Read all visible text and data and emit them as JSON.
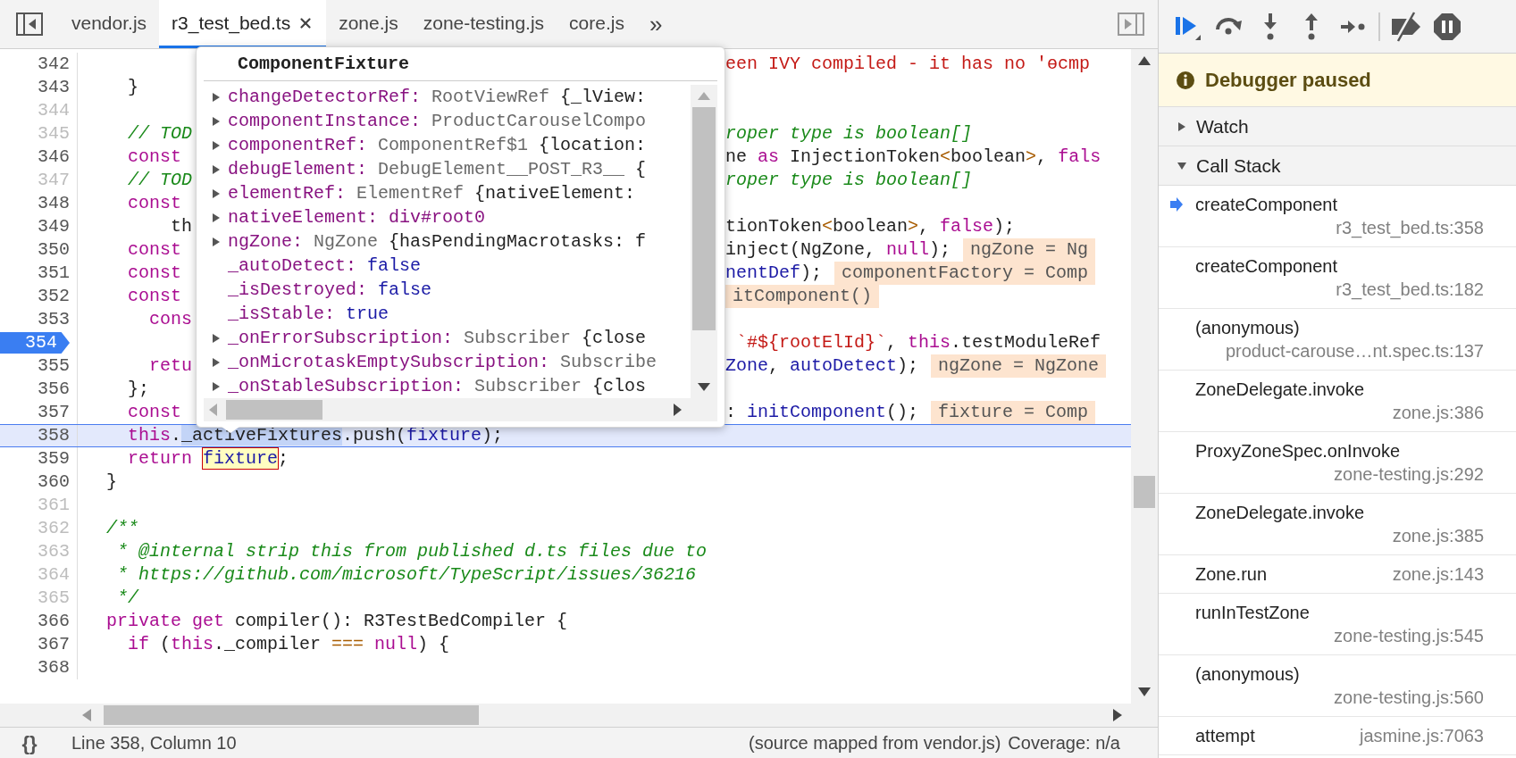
{
  "tabs": {
    "items": [
      {
        "label": "vendor.js",
        "selected": false,
        "closable": false
      },
      {
        "label": "r3_test_bed.ts",
        "selected": true,
        "closable": true
      },
      {
        "label": "zone.js",
        "selected": false,
        "closable": false
      },
      {
        "label": "zone-testing.js",
        "selected": false,
        "closable": false
      },
      {
        "label": "core.js",
        "selected": false,
        "closable": false
      }
    ],
    "more": "»"
  },
  "editor": {
    "lines": [
      {
        "n": "342",
        "kind": "split",
        "dim": false,
        "breakpoint": false,
        "current": false,
        "right": [
          {
            "kind": "str",
            "text": "een IVY compiled - it has no 'ɵcmp"
          }
        ]
      },
      {
        "n": "343",
        "kind": "split",
        "dim": false,
        "breakpoint": false,
        "current": false,
        "left": [
          {
            "kind": "p",
            "text": "    }"
          }
        ]
      },
      {
        "n": "344",
        "kind": "split",
        "dim": true,
        "breakpoint": false,
        "current": false
      },
      {
        "n": "345",
        "kind": "split",
        "dim": true,
        "breakpoint": false,
        "current": false,
        "left": [
          {
            "kind": "cm",
            "text": "    // TOD"
          }
        ],
        "right": [
          {
            "kind": "cm",
            "text": "roper type is boolean[]"
          }
        ]
      },
      {
        "n": "346",
        "kind": "split",
        "dim": false,
        "breakpoint": false,
        "current": false,
        "left": [
          {
            "kind": "kw",
            "text": "    const"
          }
        ],
        "right": [
          {
            "kind": "p",
            "text": "ne "
          },
          {
            "kind": "kw",
            "text": "as"
          },
          {
            "kind": "p",
            "text": " InjectionToken"
          },
          {
            "kind": "op",
            "text": "<"
          },
          {
            "kind": "p",
            "text": "boolean"
          },
          {
            "kind": "op",
            "text": ">"
          },
          {
            "kind": "p",
            "text": ", "
          },
          {
            "kind": "kw",
            "text": "fals"
          }
        ]
      },
      {
        "n": "347",
        "kind": "split",
        "dim": true,
        "breakpoint": false,
        "current": false,
        "left": [
          {
            "kind": "cm",
            "text": "    // TOD"
          }
        ],
        "right": [
          {
            "kind": "cm",
            "text": "roper type is boolean[]"
          }
        ]
      },
      {
        "n": "348",
        "kind": "split",
        "dim": false,
        "breakpoint": false,
        "current": false,
        "left": [
          {
            "kind": "kw",
            "text": "    const"
          }
        ]
      },
      {
        "n": "349",
        "kind": "split",
        "dim": false,
        "breakpoint": false,
        "current": false,
        "left": [
          {
            "kind": "p",
            "text": "        th"
          }
        ],
        "right": [
          {
            "kind": "p",
            "text": "tionToken"
          },
          {
            "kind": "op",
            "text": "<"
          },
          {
            "kind": "p",
            "text": "boolean"
          },
          {
            "kind": "op",
            "text": ">"
          },
          {
            "kind": "p",
            "text": ", "
          },
          {
            "kind": "kw",
            "text": "false"
          },
          {
            "kind": "p",
            "text": ");"
          }
        ]
      },
      {
        "n": "350",
        "kind": "split",
        "dim": false,
        "breakpoint": false,
        "current": false,
        "left": [
          {
            "kind": "kw",
            "text": "    const"
          }
        ],
        "right": [
          {
            "kind": "p",
            "text": "inject(NgZone, "
          },
          {
            "kind": "kw",
            "text": "null"
          },
          {
            "kind": "p",
            "text": ");"
          },
          {
            "kind": "val",
            "text": "ngZone = Ng"
          }
        ]
      },
      {
        "n": "351",
        "kind": "split",
        "dim": false,
        "breakpoint": false,
        "current": false,
        "left": [
          {
            "kind": "kw",
            "text": "    const"
          }
        ],
        "right": [
          {
            "kind": "var",
            "text": "nentDef"
          },
          {
            "kind": "p",
            "text": ");"
          },
          {
            "kind": "val",
            "text": "componentFactory = Comp"
          }
        ]
      },
      {
        "n": "352",
        "kind": "split",
        "dim": false,
        "breakpoint": false,
        "current": false,
        "left": [
          {
            "kind": "kw",
            "text": "    const"
          }
        ],
        "right": [
          {
            "kind": "val",
            "text": "itComponent()"
          }
        ]
      },
      {
        "n": "353",
        "kind": "split",
        "dim": false,
        "breakpoint": false,
        "current": false,
        "left": [
          {
            "kind": "kw",
            "text": "      cons"
          }
        ]
      },
      {
        "n": "354",
        "kind": "split",
        "dim": false,
        "breakpoint": true,
        "current": false,
        "right": [
          {
            "kind": "str",
            "text": " `#${rootElId}`"
          },
          {
            "kind": "p",
            "text": ", "
          },
          {
            "kind": "kw",
            "text": "this"
          },
          {
            "kind": "p",
            "text": ".testModuleRef"
          }
        ]
      },
      {
        "n": "355",
        "kind": "split",
        "dim": false,
        "breakpoint": false,
        "current": false,
        "left": [
          {
            "kind": "kw",
            "text": "      retu"
          }
        ],
        "right": [
          {
            "kind": "var",
            "text": "Zone"
          },
          {
            "kind": "p",
            "text": ", "
          },
          {
            "kind": "var",
            "text": "autoDetect"
          },
          {
            "kind": "p",
            "text": ");"
          },
          {
            "kind": "val",
            "text": "ngZone = NgZone"
          }
        ]
      },
      {
        "n": "356",
        "kind": "split",
        "dim": false,
        "breakpoint": false,
        "current": false,
        "left": [
          {
            "kind": "p",
            "text": "    };"
          }
        ]
      },
      {
        "n": "357",
        "kind": "split",
        "dim": false,
        "breakpoint": false,
        "current": false,
        "left": [
          {
            "kind": "kw",
            "text": "    const"
          }
        ],
        "right": [
          {
            "kind": "p",
            "text": ": "
          },
          {
            "kind": "var",
            "text": "initComponent"
          },
          {
            "kind": "p",
            "text": "();"
          },
          {
            "kind": "val",
            "text": "fixture = Comp"
          }
        ]
      },
      {
        "n": "358",
        "kind": "full",
        "dim": false,
        "breakpoint": false,
        "current": true,
        "tokens": [
          {
            "kind": "kw",
            "text": "    this"
          },
          {
            "kind": "p",
            "text": "."
          },
          {
            "kind": "sel",
            "text": "_activeFixtures"
          },
          {
            "kind": "p",
            "text": ".push("
          },
          {
            "kind": "var",
            "text": "fixture"
          },
          {
            "kind": "p",
            "text": ");"
          }
        ]
      },
      {
        "n": "359",
        "kind": "full",
        "dim": false,
        "breakpoint": false,
        "current": false,
        "tokens": [
          {
            "kind": "kw",
            "text": "    return "
          },
          {
            "kind": "hl",
            "text": "fixture"
          },
          {
            "kind": "p",
            "text": ";"
          }
        ]
      },
      {
        "n": "360",
        "kind": "full",
        "dim": false,
        "breakpoint": false,
        "current": false,
        "tokens": [
          {
            "kind": "p",
            "text": "  }"
          }
        ]
      },
      {
        "n": "361",
        "kind": "full",
        "dim": true,
        "breakpoint": false,
        "current": false
      },
      {
        "n": "362",
        "kind": "full",
        "dim": true,
        "breakpoint": false,
        "current": false,
        "tokens": [
          {
            "kind": "cm",
            "text": "  /**"
          }
        ]
      },
      {
        "n": "363",
        "kind": "full",
        "dim": true,
        "breakpoint": false,
        "current": false,
        "tokens": [
          {
            "kind": "cm",
            "text": "   * @internal strip this from published d.ts files due to"
          }
        ]
      },
      {
        "n": "364",
        "kind": "full",
        "dim": true,
        "breakpoint": false,
        "current": false,
        "tokens": [
          {
            "kind": "cm",
            "text": "   * https://github.com/microsoft/TypeScript/issues/36216"
          }
        ]
      },
      {
        "n": "365",
        "kind": "full",
        "dim": true,
        "breakpoint": false,
        "current": false,
        "tokens": [
          {
            "kind": "cm",
            "text": "   */"
          }
        ]
      },
      {
        "n": "366",
        "kind": "full",
        "dim": false,
        "breakpoint": false,
        "current": false,
        "tokens": [
          {
            "kind": "kw",
            "text": "  private get"
          },
          {
            "kind": "p",
            "text": " compiler(): R3TestBedCompiler {"
          }
        ]
      },
      {
        "n": "367",
        "kind": "full",
        "dim": false,
        "breakpoint": false,
        "current": false,
        "tokens": [
          {
            "kind": "kw",
            "text": "    if"
          },
          {
            "kind": "p",
            "text": " ("
          },
          {
            "kind": "kw",
            "text": "this"
          },
          {
            "kind": "p",
            "text": "._compiler "
          },
          {
            "kind": "op",
            "text": "==="
          },
          {
            "kind": "kw",
            "text": " null"
          },
          {
            "kind": "p",
            "text": ") {"
          }
        ]
      },
      {
        "n": "368",
        "kind": "full",
        "dim": false,
        "breakpoint": false,
        "current": false
      }
    ]
  },
  "popover": {
    "title": "ComponentFixture",
    "rows": [
      {
        "key": "changeDetectorRef:",
        "expandable": true,
        "value": [
          {
            "kind": "type",
            "text": " RootViewRef"
          },
          {
            "kind": "text",
            "text": " {_lView:"
          }
        ]
      },
      {
        "key": "componentInstance:",
        "expandable": true,
        "value": [
          {
            "kind": "type",
            "text": " ProductCarouselCompo"
          }
        ]
      },
      {
        "key": "componentRef:",
        "expandable": true,
        "value": [
          {
            "kind": "type",
            "text": " ComponentRef$1"
          },
          {
            "kind": "text",
            "text": " {location:"
          }
        ]
      },
      {
        "key": "debugElement:",
        "expandable": true,
        "value": [
          {
            "kind": "type",
            "text": " DebugElement__POST_R3__"
          },
          {
            "kind": "text",
            "text": " {"
          }
        ]
      },
      {
        "key": "elementRef:",
        "expandable": true,
        "value": [
          {
            "kind": "type",
            "text": " ElementRef"
          },
          {
            "kind": "text",
            "text": " {nativeElement:"
          }
        ]
      },
      {
        "key": "nativeElement:",
        "expandable": true,
        "value": [
          {
            "kind": "node",
            "text": " div#root0"
          }
        ]
      },
      {
        "key": "ngZone:",
        "expandable": true,
        "value": [
          {
            "kind": "type",
            "text": " NgZone"
          },
          {
            "kind": "text",
            "text": " {hasPendingMacrotasks: f"
          }
        ]
      },
      {
        "key": "_autoDetect:",
        "expandable": false,
        "value": [
          {
            "kind": "bool",
            "text": " false"
          }
        ]
      },
      {
        "key": "_isDestroyed:",
        "expandable": false,
        "value": [
          {
            "kind": "bool",
            "text": " false"
          }
        ]
      },
      {
        "key": "_isStable:",
        "expandable": false,
        "value": [
          {
            "kind": "bool",
            "text": " true"
          }
        ]
      },
      {
        "key": "_onErrorSubscription:",
        "expandable": true,
        "value": [
          {
            "kind": "type",
            "text": " Subscriber"
          },
          {
            "kind": "text",
            "text": " {close"
          }
        ]
      },
      {
        "key": "_onMicrotaskEmptySubscription:",
        "expandable": true,
        "value": [
          {
            "kind": "type",
            "text": " Subscribe"
          }
        ]
      },
      {
        "key": "_onStableSubscription:",
        "expandable": true,
        "value": [
          {
            "kind": "type",
            "text": " Subscriber"
          },
          {
            "kind": "text",
            "text": " {clos"
          }
        ]
      }
    ]
  },
  "status_bar": {
    "format_button": "{}",
    "position": "Line 358, Column 10",
    "source": "(source mapped from vendor.js)",
    "coverage": "Coverage: n/a"
  },
  "debugger": {
    "banner": "Debugger paused",
    "sections": [
      {
        "title": "Watch",
        "expanded": false
      },
      {
        "title": "Call Stack",
        "expanded": true
      }
    ],
    "frames": [
      {
        "name": "createComponent",
        "location": "r3_test_bed.ts:358",
        "selected": true
      },
      {
        "name": "createComponent",
        "location": "r3_test_bed.ts:182",
        "selected": false
      },
      {
        "name": "(anonymous)",
        "location": "product-carouse…nt.spec.ts:137",
        "selected": false
      },
      {
        "name": "ZoneDelegate.invoke",
        "location": "zone.js:386",
        "selected": false
      },
      {
        "name": "ProxyZoneSpec.onInvoke",
        "location": "zone-testing.js:292",
        "selected": false
      },
      {
        "name": "ZoneDelegate.invoke",
        "location": "zone.js:385",
        "selected": false
      },
      {
        "name": "Zone.run",
        "location": "zone.js:143",
        "selected": false
      },
      {
        "name": "runInTestZone",
        "location": "zone-testing.js:545",
        "selected": false
      },
      {
        "name": "(anonymous)",
        "location": "zone-testing.js:560",
        "selected": false
      },
      {
        "name": "attempt",
        "location": "jasmine.js:7063",
        "selected": false
      }
    ]
  }
}
